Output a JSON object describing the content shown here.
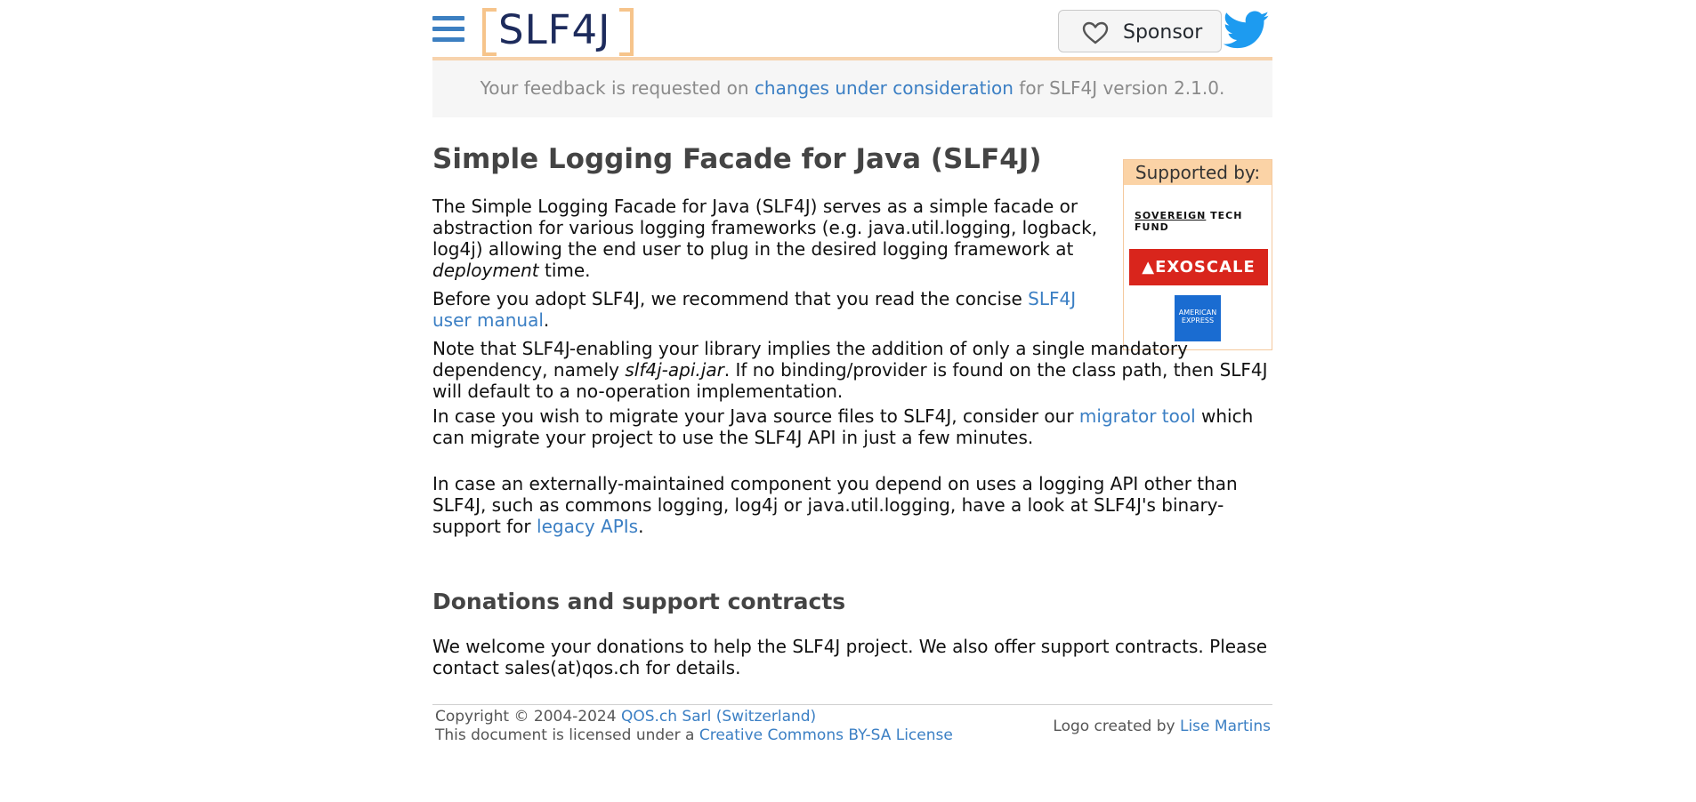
{
  "header": {
    "logo_text": "SLF4J",
    "sponsor_label": "Sponsor"
  },
  "notice": {
    "prefix": "Your feedback is requested on ",
    "link": "changes under consideration",
    "suffix": " for SLF4J version 2.1.0."
  },
  "sidebar": {
    "title": "Supported by:",
    "sponsors": {
      "stf_a": "SOVEREIGN",
      "stf_b": " TECH FUND",
      "exoscale": "EXOSCALE",
      "amex_a": "AMERICAN",
      "amex_b": "EXPRESS"
    }
  },
  "main": {
    "title": "Simple Logging Facade for Java (SLF4J)",
    "p1": {
      "text": "The Simple Logging Facade for Java (SLF4J) serves as a simple facade or abstraction for various logging frameworks (e.g. java.util.logging, logback, log4j) allowing the end user to plug in the desired logging framework at ",
      "em": "deployment",
      "tail": " time."
    },
    "p2": {
      "text": "Before you adopt SLF4J, we recommend that you read the concise ",
      "link": "SLF4J user manual",
      "tail": "."
    },
    "p3": {
      "text": "Note that SLF4J-enabling your library implies the addition of only a single mandatory dependency, namely ",
      "em": "slf4j-api.jar",
      "tail": ". If no binding/provider is found on the class path, then SLF4J will default to a no-operation implementation."
    },
    "p4": {
      "text": "In case you wish to migrate your Java source files to SLF4J, consider our ",
      "link": "migrator tool",
      "tail": " which can migrate your project to use the SLF4J API in just a few minutes."
    },
    "p5": {
      "text": "In case an externally-maintained component you depend on uses a logging API other than SLF4J, such as commons logging, log4j or java.util.logging, have a look at SLF4J's binary-support for ",
      "link": "legacy APIs",
      "tail": "."
    },
    "h2": "Donations and support contracts",
    "p6": "We welcome your donations to help the SLF4J project. We also offer support contracts. Please contact sales(at)qos.ch for details."
  },
  "footer": {
    "copyright_prefix": "Copyright © 2004-2024 ",
    "copyright_link": "QOS.ch Sarl (Switzerland)",
    "license_prefix": "This document is licensed under a ",
    "license_link": "Creative Commons BY-SA License",
    "logo_prefix": "Logo created by ",
    "logo_link": "Lise Martins"
  },
  "colors": {
    "link": "#3b7fc4",
    "accent_orange": "#f6c48b",
    "logo_navy": "#1d2b5c",
    "twitter_blue": "#1d9bf0",
    "exoscale_red": "#d9251c",
    "amex_blue": "#1a6cd1"
  },
  "icons": [
    "hamburger-menu-icon",
    "heart-icon",
    "twitter-icon"
  ]
}
